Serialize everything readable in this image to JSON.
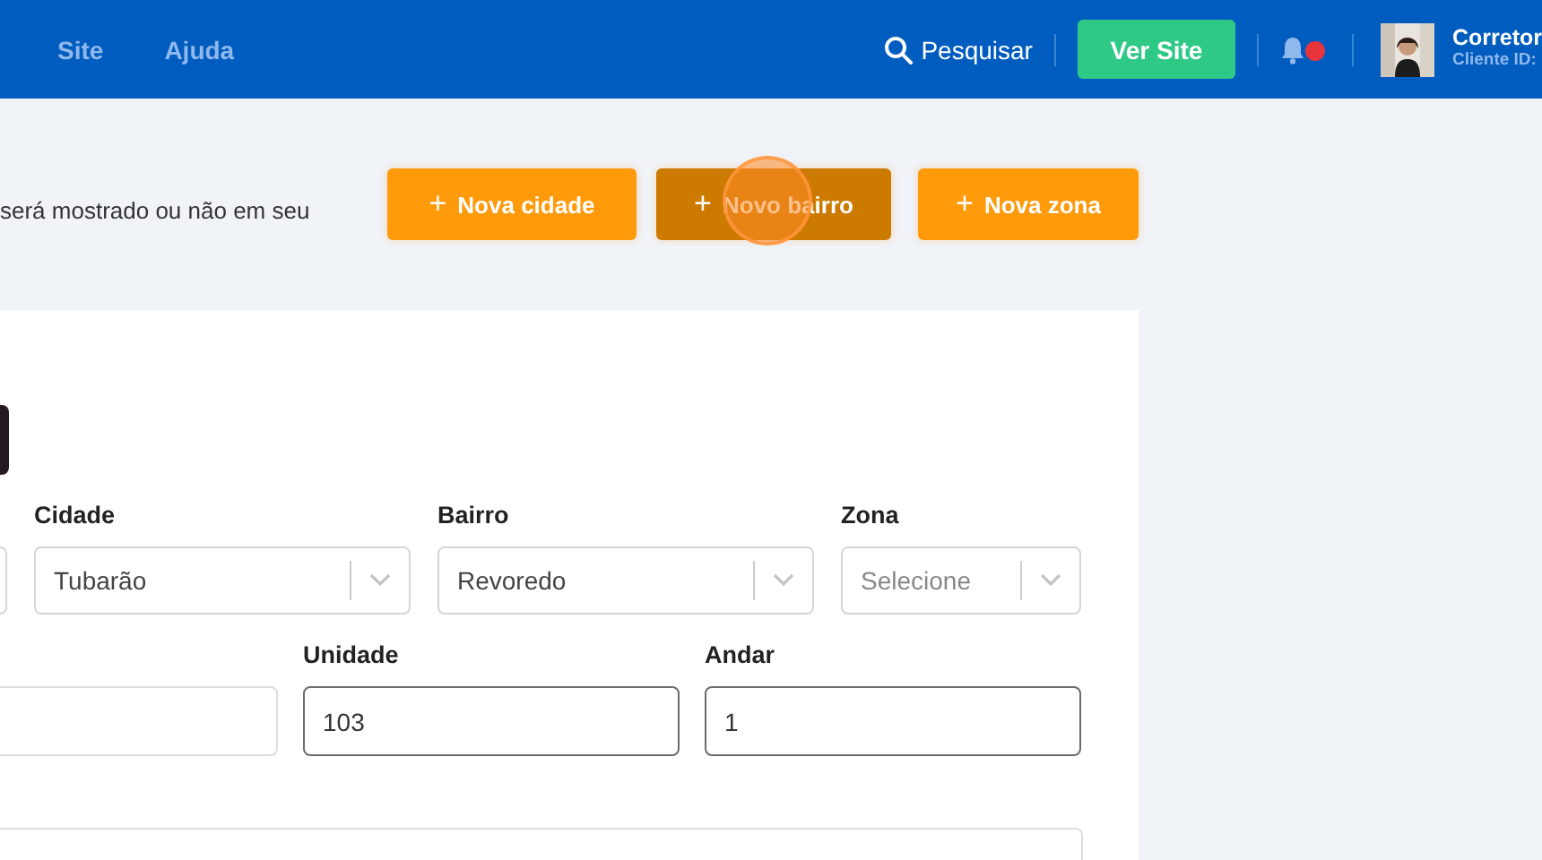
{
  "header": {
    "nav": [
      {
        "label": "Site"
      },
      {
        "label": "Ajuda"
      }
    ],
    "search": "Pesquisar",
    "view_site": "Ver Site",
    "notifications": {
      "unread": true
    },
    "user": {
      "name": "Corretor",
      "client_id_label": "Cliente ID:"
    }
  },
  "intro": "será mostrado ou não em seu",
  "actions": [
    {
      "icon": "+",
      "label": "Nova cidade",
      "hovered": false
    },
    {
      "icon": "+",
      "label": "Novo bairro",
      "hovered": true
    },
    {
      "icon": "+",
      "label": "Nova zona",
      "hovered": false
    }
  ],
  "form": {
    "rows": [
      [
        {
          "kind": "clipped"
        },
        {
          "kind": "select",
          "label": "Cidade",
          "value": "Tubarão"
        },
        {
          "kind": "select",
          "label": "Bairro",
          "value": "Revoredo"
        },
        {
          "kind": "select",
          "label": "Zona",
          "placeholder": "Selecione"
        }
      ],
      [
        {
          "kind": "input"
        },
        {
          "kind": "input",
          "label": "Unidade",
          "value": "103"
        },
        {
          "kind": "input",
          "label": "Andar",
          "value": "1"
        }
      ],
      [
        {
          "kind": "textarea"
        }
      ]
    ]
  }
}
